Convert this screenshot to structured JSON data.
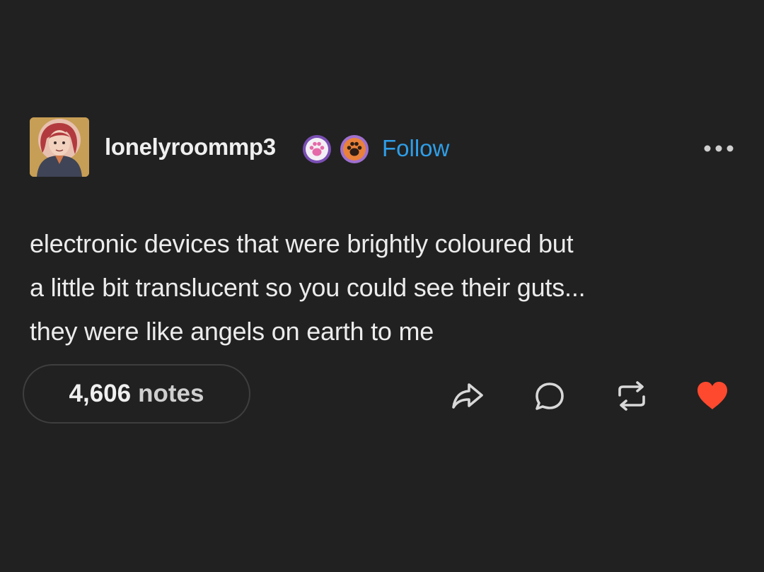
{
  "post": {
    "username": "lonelyroommp3",
    "follow_label": "Follow",
    "badges": [
      {
        "icon": "paw-badge-icon",
        "color": "#d7b8f0"
      },
      {
        "icon": "paw-badge-icon",
        "color": "#b88be0"
      }
    ],
    "body_lines": [
      "electronic devices that were brightly coloured but",
      "a little bit translucent so you could see their guts...",
      "they were like angels on earth to me"
    ],
    "notes_count": "4,606",
    "notes_label": "notes",
    "actions": [
      "share-icon",
      "reply-icon",
      "reblog-icon",
      "like-icon"
    ],
    "liked": true
  },
  "colors": {
    "background": "#212121",
    "follow": "#2e9ee8",
    "like": "#ff492f",
    "text": "#ececec"
  }
}
